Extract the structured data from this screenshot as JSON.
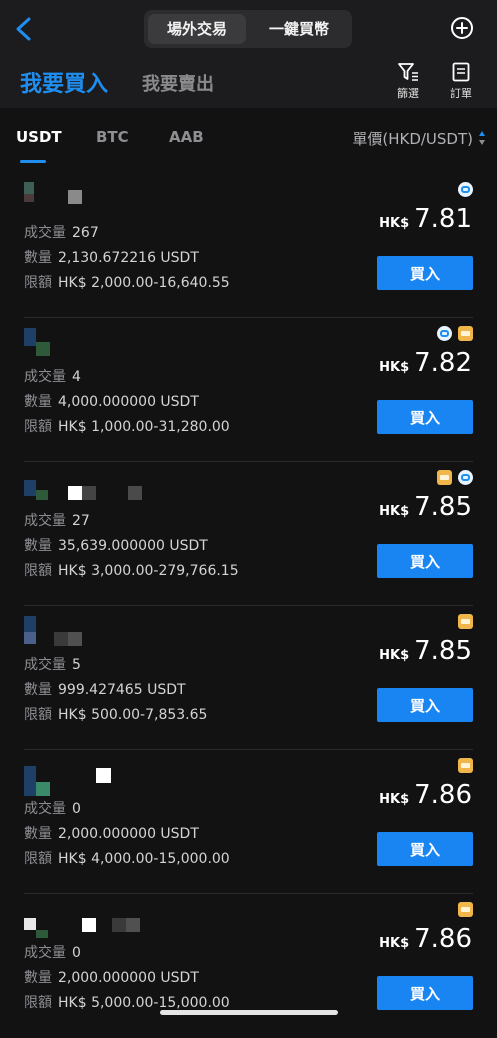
{
  "header": {
    "segments": [
      "場外交易",
      "一鍵買幣"
    ],
    "active_segment": 0
  },
  "trade_tabs": {
    "buy": "我要買入",
    "sell": "我要賣出"
  },
  "tools": {
    "filter": "篩選",
    "orders": "訂單"
  },
  "coins": [
    "USDT",
    "BTC",
    "AAB"
  ],
  "unit_label": "單價(HKD/USDT)",
  "labels": {
    "volume": "成交量",
    "amount": "數量",
    "limit": "限額",
    "buy_button": "買入",
    "currency": "HK$"
  },
  "accent_color": "#1f8ef1",
  "listings": [
    {
      "volume": "267",
      "amount": "2,130.672216 USDT",
      "limit": "HK$ 2,000.00-16,640.55",
      "price": "7.81",
      "payments": [
        "wallet"
      ]
    },
    {
      "volume": "4",
      "amount": "4,000.000000 USDT",
      "limit": "HK$ 1,000.00-31,280.00",
      "price": "7.82",
      "payments": [
        "wallet",
        "bank"
      ]
    },
    {
      "volume": "27",
      "amount": "35,639.000000 USDT",
      "limit": "HK$ 3,000.00-279,766.15",
      "price": "7.85",
      "payments": [
        "bank",
        "wallet"
      ]
    },
    {
      "volume": "5",
      "amount": "999.427465 USDT",
      "limit": "HK$ 500.00-7,853.65",
      "price": "7.85",
      "payments": [
        "bank"
      ]
    },
    {
      "volume": "0",
      "amount": "2,000.000000 USDT",
      "limit": "HK$ 4,000.00-15,000.00",
      "price": "7.86",
      "payments": [
        "bank"
      ]
    },
    {
      "volume": "0",
      "amount": "2,000.000000 USDT",
      "limit": "HK$ 5,000.00-15,000.00",
      "price": "7.86",
      "payments": [
        "bank"
      ]
    }
  ]
}
